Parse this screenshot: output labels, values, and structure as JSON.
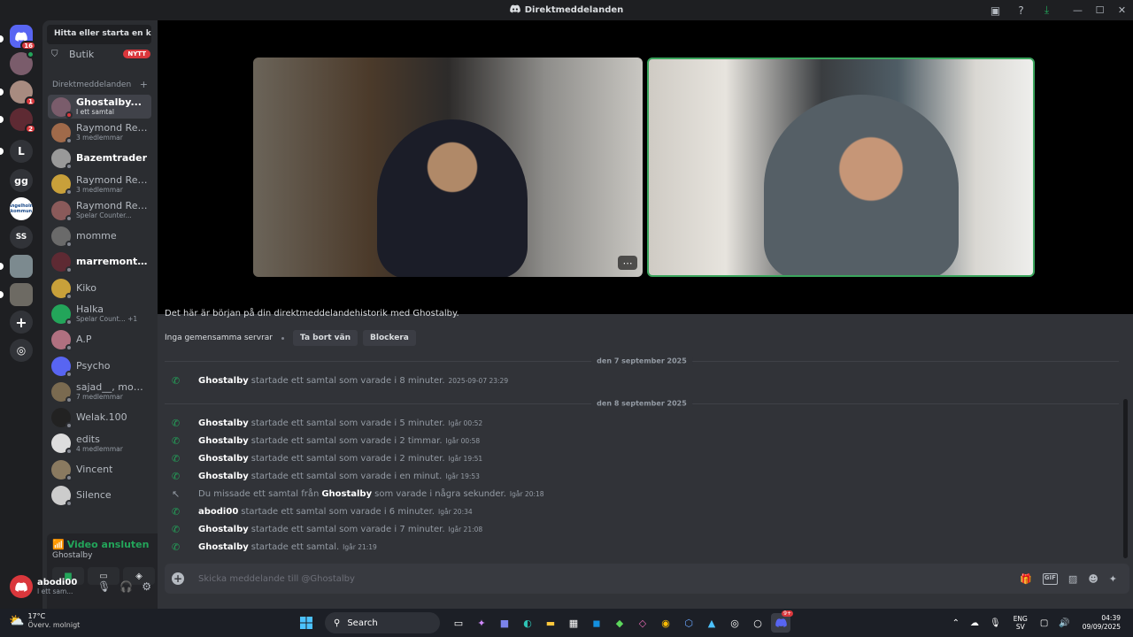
{
  "window": {
    "title": "Direktmeddelanden"
  },
  "rail": {
    "home_badge": "16",
    "servers": [
      {
        "letter": "",
        "color": "#7a5c6b",
        "badge": "",
        "top": 0
      },
      {
        "letter": "",
        "color": "#a88b80",
        "badge": "1"
      },
      {
        "letter": "",
        "color": "#5e2a33",
        "badge": "2"
      },
      {
        "letter": "L",
        "color": "#313338",
        "badge": ""
      },
      {
        "letter": "gg",
        "color": "#313338",
        "badge": ""
      },
      {
        "letter": "Ängelholm kommun",
        "color": "#ffffff",
        "badge": ""
      },
      {
        "letter": "SS",
        "color": "#313338",
        "badge": ""
      },
      {
        "letter": "",
        "color": "#7c8a8f",
        "badge": ""
      },
      {
        "letter": "",
        "color": "#6d6a63",
        "badge": ""
      }
    ]
  },
  "sidebar": {
    "search_label": "Hitta eller starta en ko...",
    "shop_label": "Butik",
    "shop_badge": "NYTT",
    "dm_header": "Direktmeddelanden",
    "dm_add": "+",
    "dms": [
      {
        "name": "Ghostalby...",
        "sub": "I ett samtal",
        "bold": true,
        "active": true,
        "color": "#7a5c6b"
      },
      {
        "name": "Raymond Red...",
        "sub": "3 medlemmar",
        "bold": false,
        "color": "#a06a4a"
      },
      {
        "name": "Bazemtrader",
        "sub": "",
        "bold": true,
        "color": "#999999"
      },
      {
        "name": "Raymond Red...",
        "sub": "3 medlemmar",
        "bold": false,
        "color": "#c8a03a"
      },
      {
        "name": "Raymond Red...",
        "sub": "Spelar Counter...",
        "bold": false,
        "color": "#8a5a5a"
      },
      {
        "name": "momme",
        "sub": "",
        "bold": false,
        "color": "#6a6a6a"
      },
      {
        "name": "marremontan...",
        "sub": "",
        "bold": true,
        "color": "#5e2a33"
      },
      {
        "name": "Kiko",
        "sub": "",
        "bold": false,
        "color": "#c8a03a"
      },
      {
        "name": "Halka",
        "sub": "Spelar Count... +1",
        "bold": false,
        "color": "#23a55a"
      },
      {
        "name": "A.P",
        "sub": "",
        "bold": false,
        "color": "#b07080"
      },
      {
        "name": "Psycho",
        "sub": "",
        "bold": false,
        "color": "#5865f2"
      },
      {
        "name": "sajad__, mom...",
        "sub": "7 medlemmar",
        "bold": false,
        "color": "#7a6a50"
      },
      {
        "name": "Welak.100",
        "sub": "",
        "bold": false,
        "color": "#222222"
      },
      {
        "name": "edits",
        "sub": "4 medlemmar",
        "bold": false,
        "color": "#dddddd"
      },
      {
        "name": "Vincent",
        "sub": "",
        "bold": false,
        "color": "#8a7a60"
      },
      {
        "name": "Silence",
        "sub": "",
        "bold": false,
        "color": "#cccccc"
      }
    ]
  },
  "voice": {
    "status": "Video ansluten",
    "channel": "Ghostalby",
    "user_name": "abodi00",
    "user_status": "I ett sam..."
  },
  "chat": {
    "intro": "Det här är början på din direktmeddelandehistorik med Ghostalby.",
    "no_servers": "Inga gemensamma servrar",
    "remove_friend": "Ta bort vän",
    "block": "Blockera",
    "date1": "den 7 september 2025",
    "date2": "den 8 september 2025",
    "messages": [
      {
        "who": "Ghostalby",
        "text": "startade ett samtal som varade i 8 minuter.",
        "ts": "2025-09-07 23:29",
        "missed": false
      },
      {
        "who": "Ghostalby",
        "text": "startade ett samtal som varade i 5 minuter.",
        "ts": "Igår 00:52",
        "missed": false
      },
      {
        "who": "Ghostalby",
        "text": "startade ett samtal som varade i 2 timmar.",
        "ts": "Igår 00:58",
        "missed": false
      },
      {
        "who": "Ghostalby",
        "text": "startade ett samtal som varade i 2 minuter.",
        "ts": "Igår 19:51",
        "missed": false
      },
      {
        "who": "Ghostalby",
        "text": "startade ett samtal som varade i en minut.",
        "ts": "Igår 19:53",
        "missed": false
      },
      {
        "pre": "Du missade ett samtal från",
        "who": "Ghostalby",
        "text": "som varade i några sekunder.",
        "ts": "Igår 20:18",
        "missed": true
      },
      {
        "who": "abodi00",
        "text": "startade ett samtal som varade i 6 minuter.",
        "ts": "Igår 20:34",
        "missed": false
      },
      {
        "who": "Ghostalby",
        "text": "startade ett samtal som varade i 7 minuter.",
        "ts": "Igår 21:08",
        "missed": false
      },
      {
        "who": "Ghostalby",
        "text": "startade ett samtal.",
        "ts": "Igår 21:19",
        "missed": false
      }
    ],
    "composer_placeholder": "Skicka meddelande till @Ghostalby"
  },
  "taskbar": {
    "temp": "17°C",
    "weather": "Överv. molnigt",
    "search": "Search",
    "lang1": "ENG",
    "lang2": "SV",
    "time": "04:39",
    "date": "09/09/2025",
    "discord_badge": "9+"
  },
  "colors": {
    "accent": "#5865f2",
    "green": "#23a55a",
    "red": "#da373c"
  }
}
